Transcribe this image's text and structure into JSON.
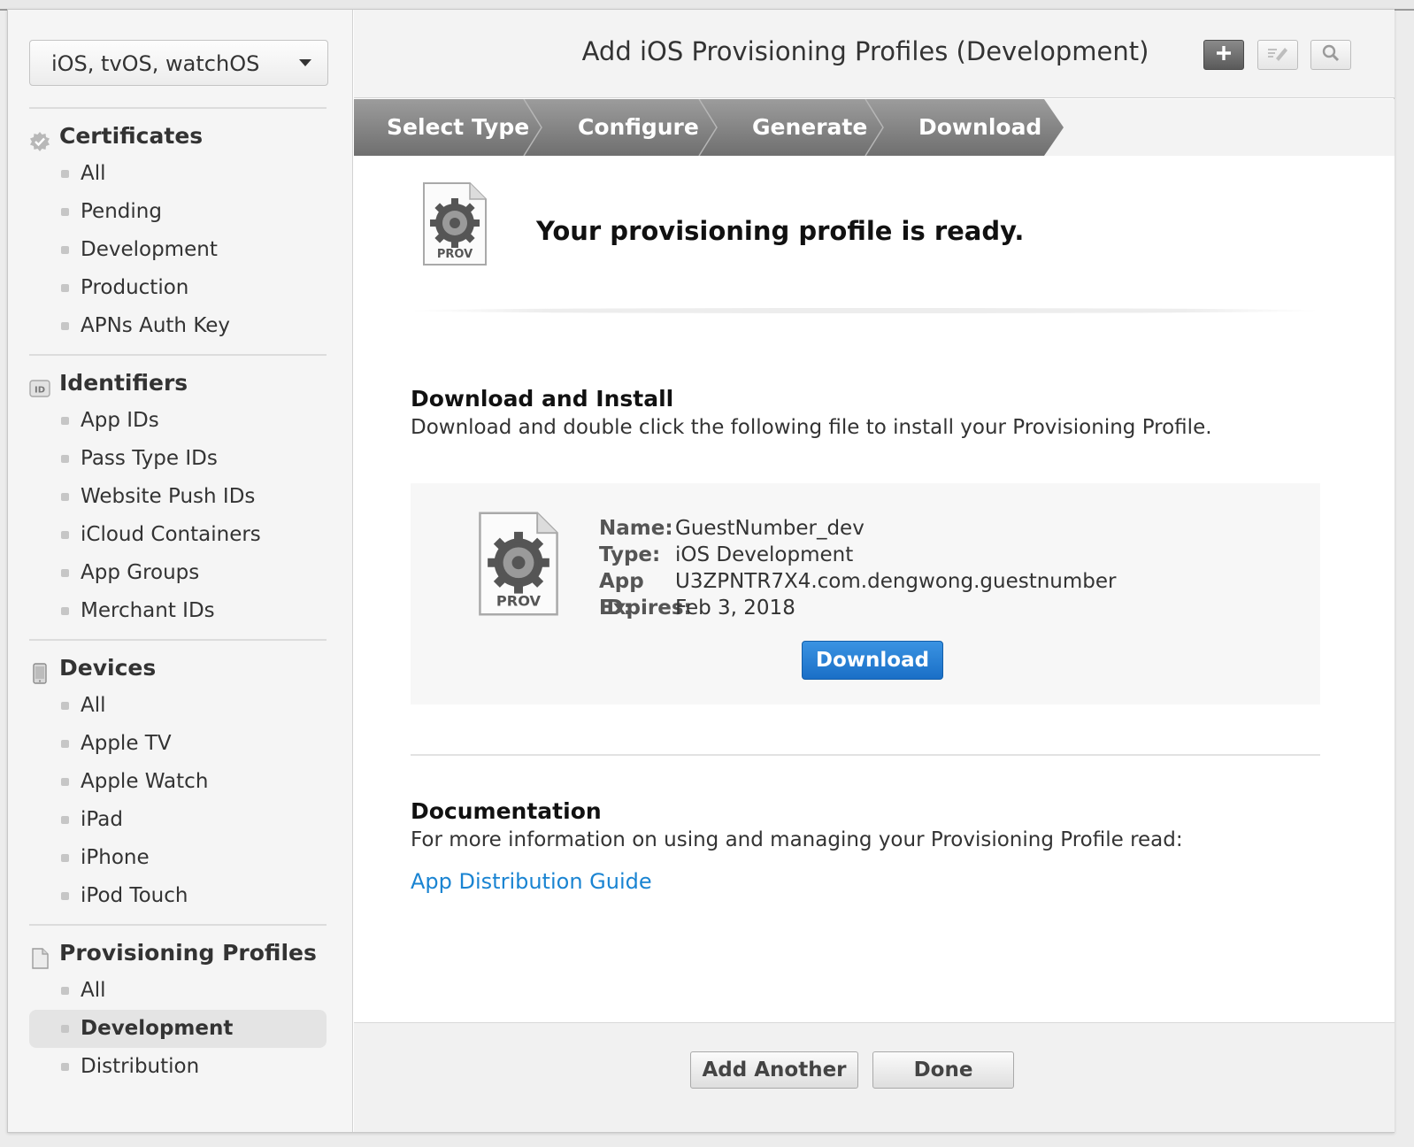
{
  "sidebar": {
    "platform": "iOS, tvOS, watchOS",
    "sections": [
      {
        "title": "Certificates",
        "icon": "certificate-icon",
        "items": [
          "All",
          "Pending",
          "Development",
          "Production",
          "APNs Auth Key"
        ]
      },
      {
        "title": "Identifiers",
        "icon": "id-badge-icon",
        "items": [
          "App IDs",
          "Pass Type IDs",
          "Website Push IDs",
          "iCloud Containers",
          "App Groups",
          "Merchant IDs"
        ]
      },
      {
        "title": "Devices",
        "icon": "device-icon",
        "items": [
          "All",
          "Apple TV",
          "Apple Watch",
          "iPad",
          "iPhone",
          "iPod Touch"
        ]
      },
      {
        "title": "Provisioning Profiles",
        "icon": "document-icon",
        "items": [
          "All",
          "Development",
          "Distribution"
        ]
      }
    ],
    "active": "Provisioning Profiles / Development"
  },
  "header": {
    "title": "Add iOS Provisioning Profiles (Development)",
    "buttons": [
      "plus-icon",
      "edit-icon",
      "search-icon"
    ]
  },
  "steps": [
    "Select Type",
    "Configure",
    "Generate",
    "Download"
  ],
  "content": {
    "icon_label": "PROV",
    "ready_text": "Your provisioning profile is ready.",
    "install_title": "Download and Install",
    "install_text": "Download and double click the following file to install your Provisioning Profile.",
    "file": {
      "name_label": "Name:",
      "name": "GuestNumber_dev",
      "type_label": "Type:",
      "type": "iOS Development",
      "appid_label": "App ID:",
      "appid": "U3ZPNTR7X4.com.dengwong.guestnumber",
      "expires_label": "Expires:",
      "expires": "Feb 3, 2018"
    },
    "download_label": "Download",
    "doc_title": "Documentation",
    "doc_text": "For more information on using and managing your Provisioning Profile read:",
    "doc_link": "App Distribution Guide"
  },
  "footer": {
    "add_another": "Add Another",
    "done": "Done"
  },
  "colors": {
    "accent_blue": "#1a6fc7",
    "link_blue": "#1a84d2",
    "step_bar": "#7f7f7f"
  }
}
